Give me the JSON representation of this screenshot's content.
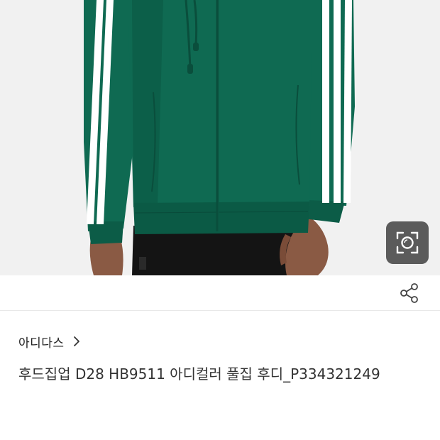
{
  "colors": {
    "jacket": "#0f6a52",
    "jacket_dark": "#0a4e3c",
    "stripes": "#ffffff",
    "pants": "#141414",
    "skin": "#8a5a44",
    "background": "#f1f1f1",
    "lens_button_bg": "#464646"
  },
  "image": {
    "subject": "green three-stripe full-zip hoodie"
  },
  "icons": {
    "lens": "lens-search-icon",
    "share": "share-icon",
    "chevron": "chevron-right-icon"
  },
  "brand": {
    "name": "아디다스"
  },
  "product": {
    "title": "후드집업 D28 HB9511 아디컬러 풀집 후디_P334321249"
  }
}
